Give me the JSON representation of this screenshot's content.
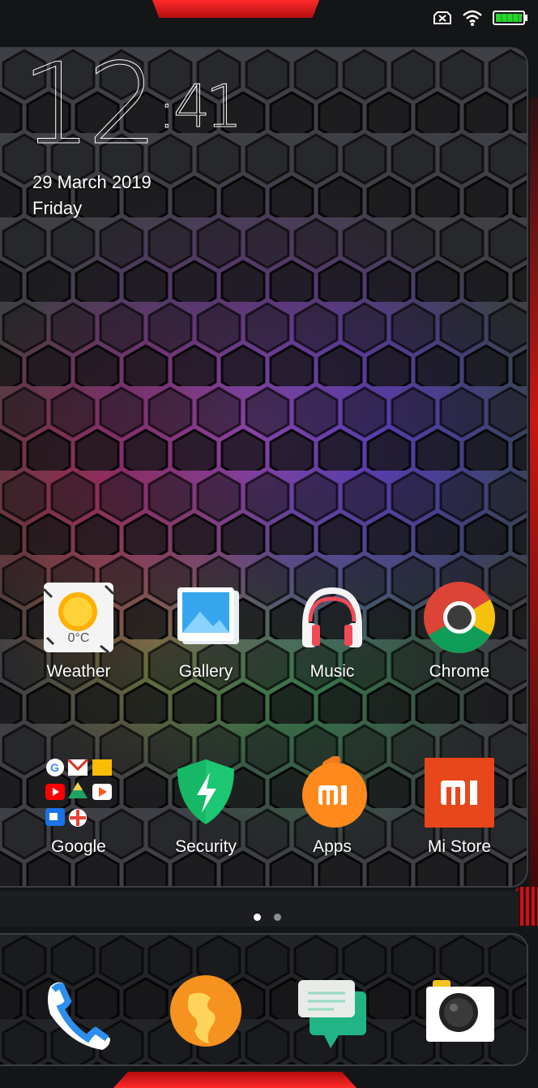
{
  "status_bar": {
    "icons": [
      "no-sim-icon",
      "wifi-icon",
      "battery-icon"
    ],
    "battery_color": "#28d52e"
  },
  "clock": {
    "hours": "12",
    "separator": ":",
    "minutes": "41"
  },
  "date": {
    "full": "29 March 2019",
    "weekday": "Friday"
  },
  "apps_row1": [
    {
      "label": "Weather",
      "icon": "weather-icon",
      "temp": "0°C"
    },
    {
      "label": "Gallery",
      "icon": "gallery-icon"
    },
    {
      "label": "Music",
      "icon": "headphones-icon"
    },
    {
      "label": "Chrome",
      "icon": "chrome-icon"
    }
  ],
  "apps_row2": [
    {
      "label": "Google",
      "icon": "google-folder-icon"
    },
    {
      "label": "Security",
      "icon": "security-shield-icon"
    },
    {
      "label": "Apps",
      "icon": "mi-apps-icon"
    },
    {
      "label": "Mi Store",
      "icon": "mi-store-icon"
    }
  ],
  "dock": [
    {
      "icon": "phone-icon"
    },
    {
      "icon": "browser-icon"
    },
    {
      "icon": "messages-icon"
    },
    {
      "icon": "camera-icon"
    }
  ],
  "page_indicator": {
    "pages": 2,
    "current": 1
  },
  "colors": {
    "accent_red": "#e01919",
    "panel_border": "#3b3d42"
  }
}
